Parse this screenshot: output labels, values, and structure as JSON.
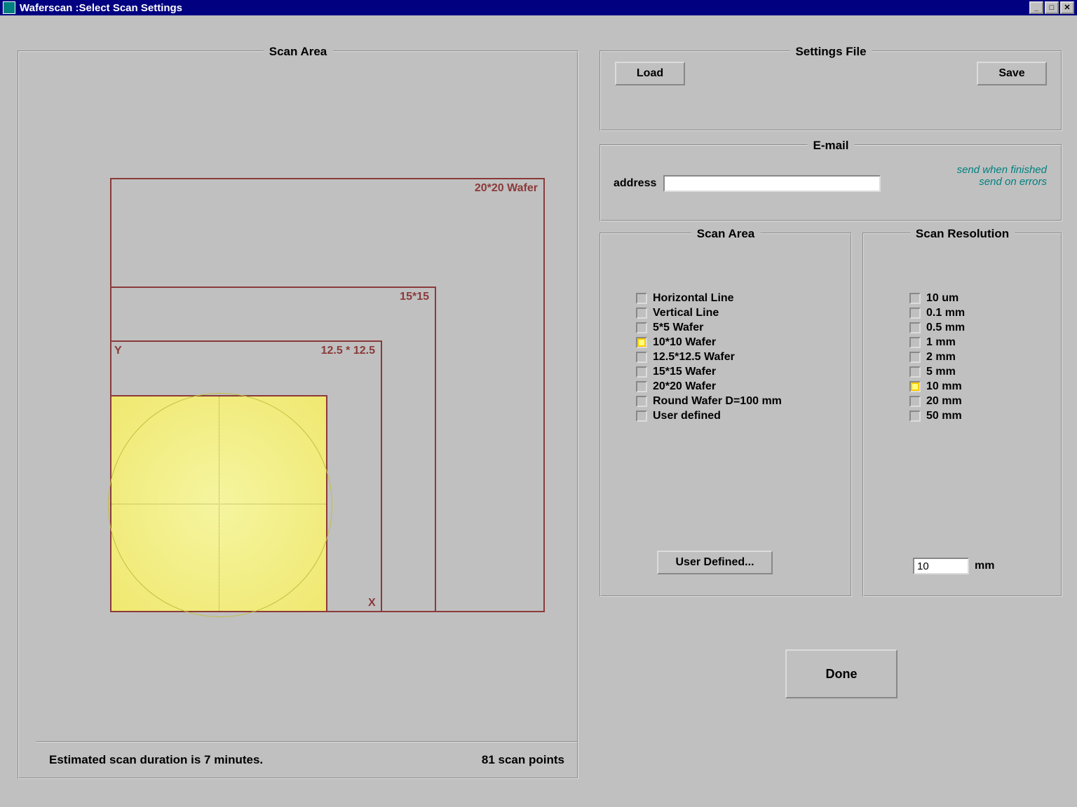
{
  "window": {
    "title": "Waferscan :Select Scan Settings",
    "min": "_",
    "max": "□",
    "close": "✕"
  },
  "left": {
    "title": "Scan Area",
    "labels": {
      "r1": "20*20 Wafer",
      "r2": "15*15",
      "r3": "12.5 * 12.5",
      "x": "X",
      "y": "Y"
    },
    "status_duration": "Estimated scan duration is 7 minutes.",
    "status_points": "81 scan points"
  },
  "settings_file": {
    "title": "Settings File",
    "load": "Load",
    "save": "Save"
  },
  "email": {
    "title": "E-mail",
    "address_label": "address",
    "address_value": "",
    "line1": "send when finished",
    "line2": "send on errors"
  },
  "scan_area": {
    "title": "Scan Area",
    "items": [
      {
        "label": "Horizontal Line",
        "selected": false
      },
      {
        "label": "Vertical Line",
        "selected": false
      },
      {
        "label": "5*5 Wafer",
        "selected": false
      },
      {
        "label": "10*10 Wafer",
        "selected": true
      },
      {
        "label": "12.5*12.5 Wafer",
        "selected": false
      },
      {
        "label": "15*15 Wafer",
        "selected": false
      },
      {
        "label": "20*20 Wafer",
        "selected": false
      },
      {
        "label": "Round Wafer D=100 mm",
        "selected": false
      },
      {
        "label": "User defined",
        "selected": false
      }
    ],
    "user_defined_btn": "User Defined..."
  },
  "scan_res": {
    "title": "Scan Resolution",
    "items": [
      {
        "label": "10 um",
        "selected": false
      },
      {
        "label": "0.1 mm",
        "selected": false
      },
      {
        "label": "0.5 mm",
        "selected": false
      },
      {
        "label": "1 mm",
        "selected": false
      },
      {
        "label": "2 mm",
        "selected": false
      },
      {
        "label": "5 mm",
        "selected": false
      },
      {
        "label": "10 mm",
        "selected": true
      },
      {
        "label": "20 mm",
        "selected": false
      },
      {
        "label": "50 mm",
        "selected": false
      }
    ],
    "value": "10",
    "unit": "mm"
  },
  "done": "Done"
}
